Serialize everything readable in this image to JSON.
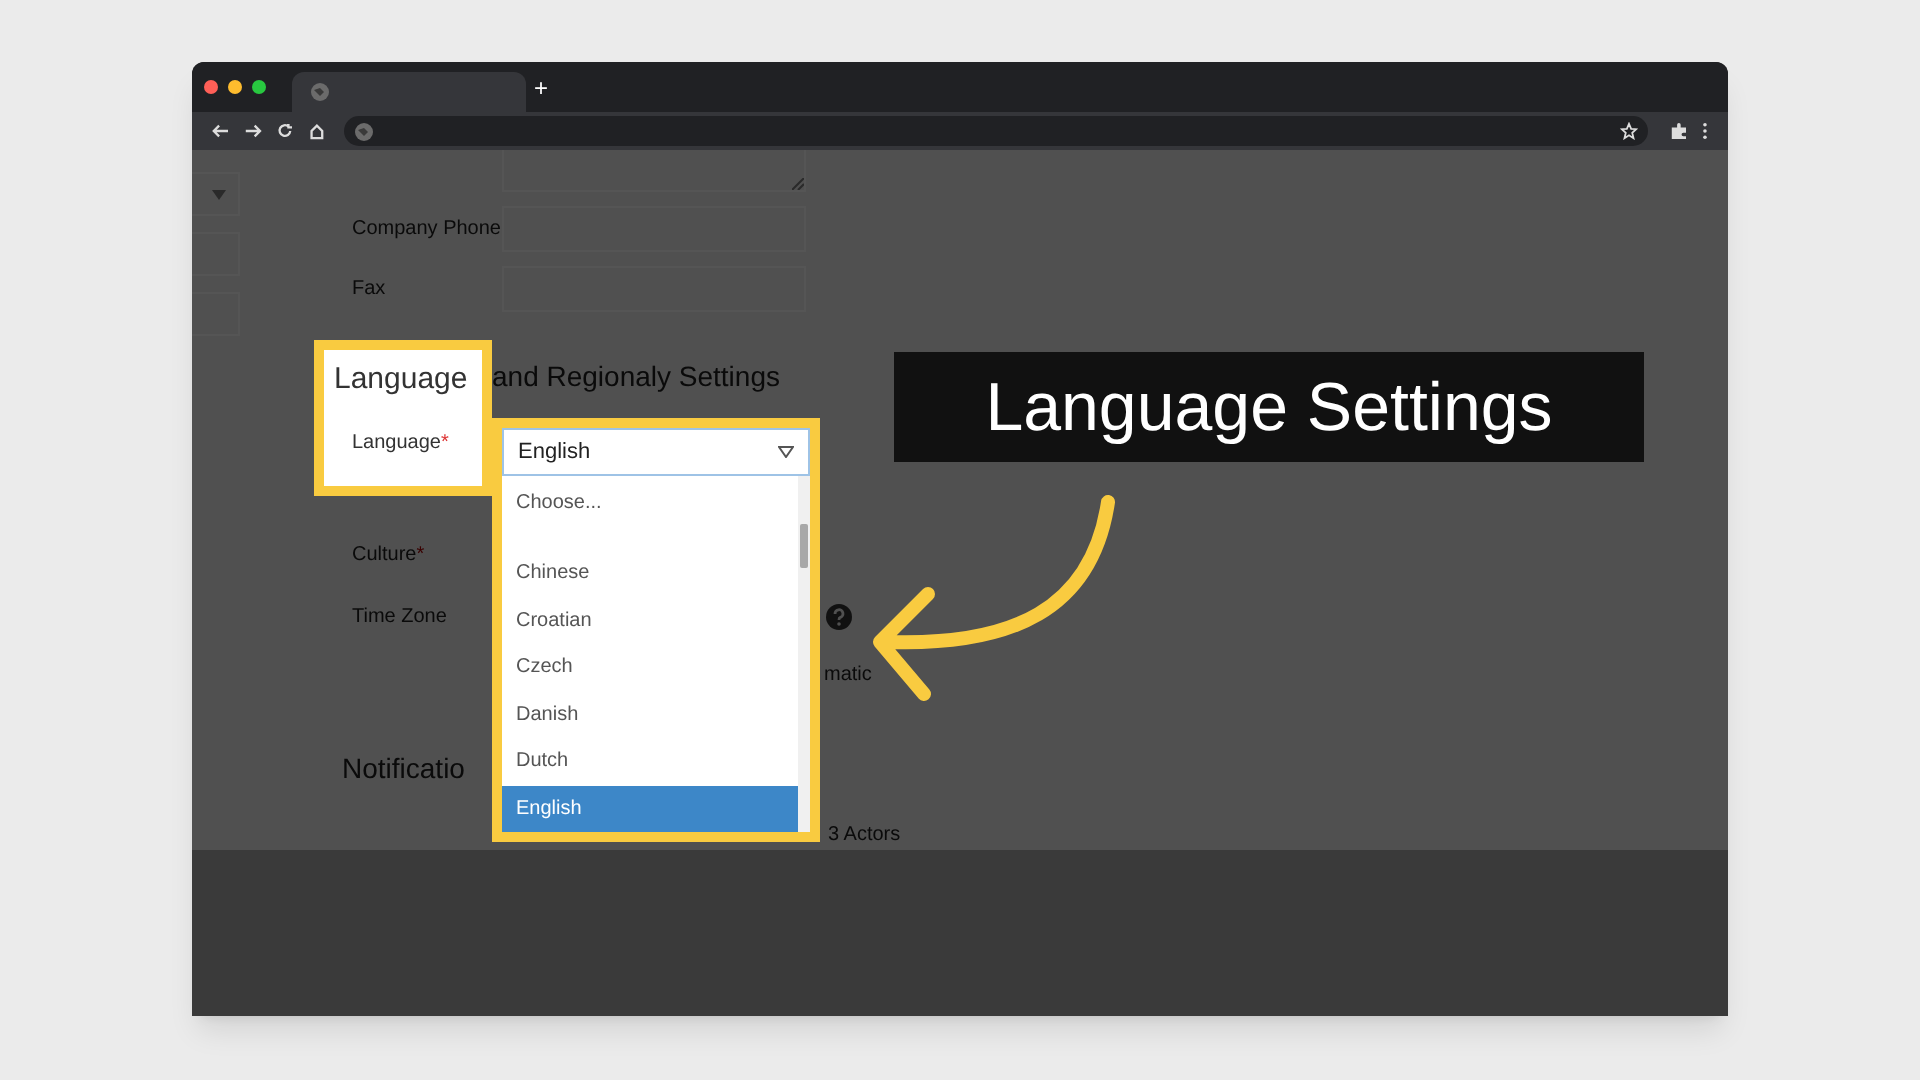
{
  "browser": {
    "new_tab": "+"
  },
  "form": {
    "fields": [
      {
        "label": "Company Phone"
      },
      {
        "label": "Fax"
      }
    ],
    "heading_tail": "and Regionaly Settings",
    "rows": [
      {
        "label": "Culture",
        "required_mark": "*"
      },
      {
        "label": "Time Zone"
      }
    ],
    "partial_text": "matic",
    "notification_heading": "Notificatio",
    "actors_text": "3 Actors"
  },
  "highlight": {
    "heading": "Language",
    "label": "Language",
    "required_mark": "*",
    "select": {
      "value": "English",
      "options": [
        {
          "label": "Choose...",
          "selected": false
        },
        {
          "label": "Chinese",
          "selected": false
        },
        {
          "label": "Croatian",
          "selected": false
        },
        {
          "label": "Czech",
          "selected": false
        },
        {
          "label": "Danish",
          "selected": false
        },
        {
          "label": "Dutch",
          "selected": false
        },
        {
          "label": "English",
          "selected": true
        }
      ]
    }
  },
  "banner": {
    "title": "Language Settings"
  }
}
